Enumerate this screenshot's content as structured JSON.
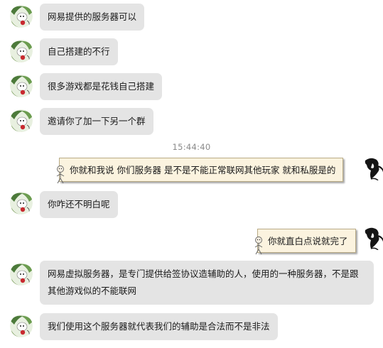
{
  "chat": {
    "messages": [
      {
        "text": "网易提供的服务器可以"
      },
      {
        "text": "自己搭建的不行"
      },
      {
        "text": "很多游戏都是花钱自己搭建"
      },
      {
        "text": "邀请你了加一下另一个群"
      },
      {
        "text": "你就和我说  你们服务器 是不是不能正常联网其他玩家  就和私服是的"
      },
      {
        "text": "你咋还不明白呢"
      },
      {
        "text": "你就直白点说就完了"
      },
      {
        "text": "网易虚拟服务器，是专门提供给签协议造辅助的人，使用的一种服务器，不是跟其他游戏似的不能联网"
      },
      {
        "text": "我们使用这个服务器就代表我们的辅助是合法而不是非法"
      }
    ],
    "timestamp": "15:44:40"
  },
  "colors": {
    "left_bubble": "#e4e4e4",
    "right_bubble": "#fbf3df",
    "right_bubble_border": "#b9ab86",
    "timestamp": "#8a8a8a"
  },
  "icons": {
    "left_avatar": "cartoon-character-avatar",
    "right_avatar": "ink-sketch-avatar",
    "bubble_decoration": "pushpin-figure"
  }
}
